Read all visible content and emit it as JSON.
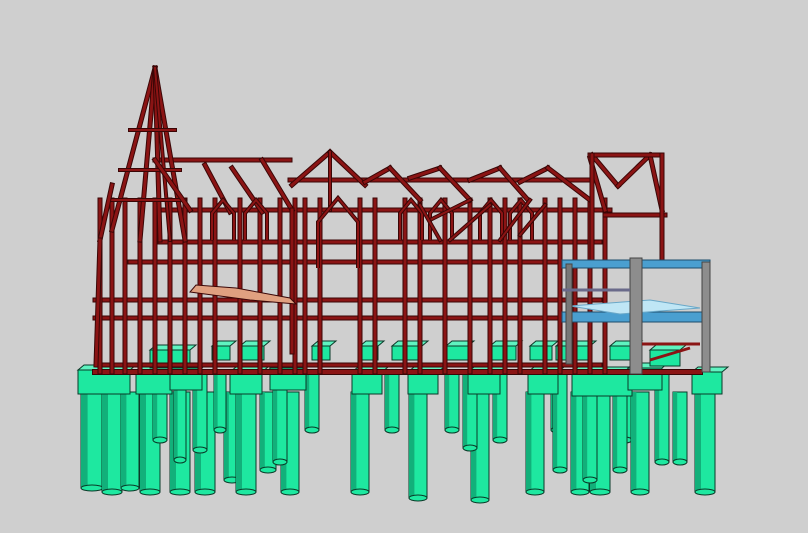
{
  "viewport": {
    "background": "#cfcfcf"
  },
  "model": {
    "frame_color": "#8b1414",
    "frame_edge_color": "#3a0606",
    "pile_color": "#1ee8a0",
    "pile_shade_color": "#12b07a",
    "pile_edge_color": "#0a3a28",
    "slab_color": "#4a9fd0",
    "slab_light_color": "#bfe6f5",
    "column_color": "#8d8d8d",
    "beam_floor_color": "#e0a080"
  }
}
